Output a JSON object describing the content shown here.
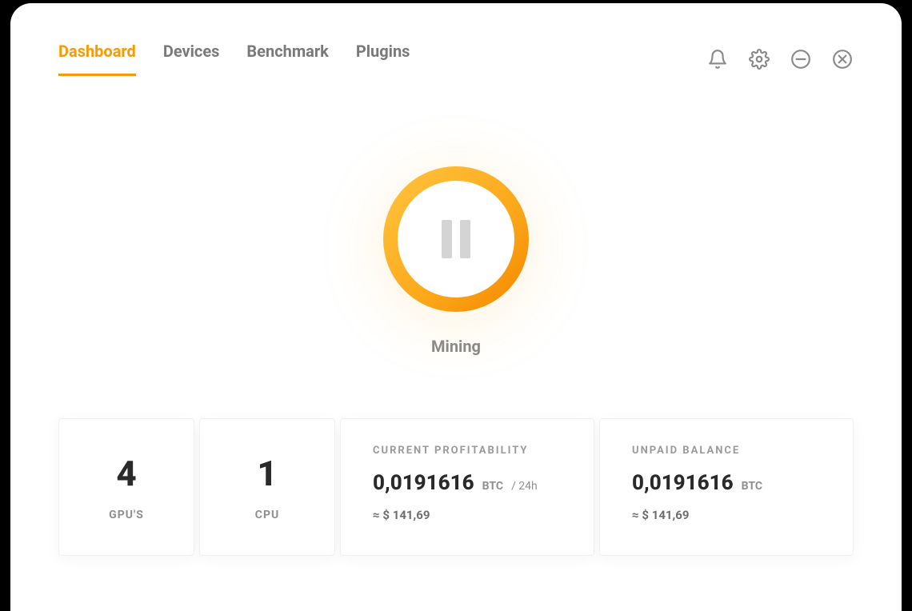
{
  "tabs": {
    "dashboard": "Dashboard",
    "devices": "Devices",
    "benchmark": "Benchmark",
    "plugins": "Plugins"
  },
  "mining": {
    "status_label": "Mining"
  },
  "stats": {
    "gpu": {
      "value": "4",
      "label": "GPU'S"
    },
    "cpu": {
      "value": "1",
      "label": "CPU"
    },
    "profitability": {
      "title": "CURRENT PROFITABILITY",
      "value": "0,0191616",
      "unit": "BTC",
      "per": "/ 24h",
      "approx": "≈ $ 141,69"
    },
    "balance": {
      "title": "UNPAID BALANCE",
      "value": "0,0191616",
      "unit": "BTC",
      "approx": "≈ $ 141,69"
    }
  },
  "colors": {
    "accent": "#f99a00"
  }
}
